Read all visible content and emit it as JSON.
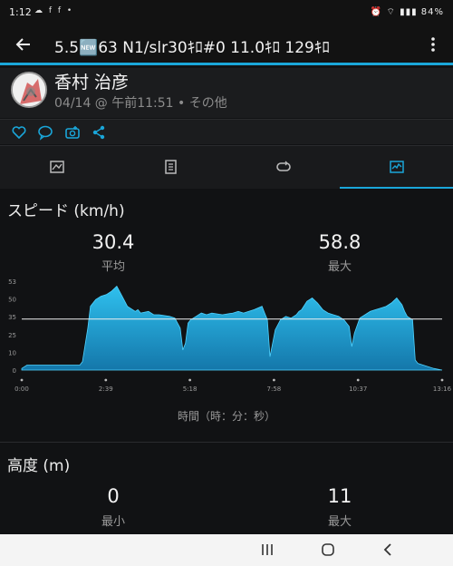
{
  "status_bar": {
    "time": "1:12",
    "left_icons": "☁ f f •",
    "right_icons": "⏰ ⌔ ▮▮▮ ",
    "battery": "84%"
  },
  "app_bar": {
    "title": "5.5🆕63 N1/slr30ｷﾛ#0 11.0ｷﾛ 129ｷﾛ"
  },
  "profile": {
    "name": "香村 治彦",
    "meta": "04/14 @ 午前11:51 • その他"
  },
  "speed": {
    "title": "スピード (km/h)",
    "avg_value": "30.4",
    "avg_label": "平均",
    "max_value": "58.8",
    "max_label": "最大",
    "x_axis_title": "時間（時：分：秒）"
  },
  "altitude": {
    "title": "高度 (m)",
    "min_value": "0",
    "min_label": "最小",
    "max_value": "11",
    "max_label": "最大"
  },
  "colors": {
    "accent": "#1aa6d9",
    "area_top": "#2fc0ee",
    "area_bottom": "#1477aa"
  },
  "chart_data": {
    "type": "area",
    "title": "スピード (km/h)",
    "xlabel": "時間（時：分：秒）",
    "ylabel": "",
    "x_tick_labels": [
      "0:00",
      "2:39",
      "5:18",
      "7:58",
      "10:37",
      "13:16"
    ],
    "y_tick_labels": [
      "0",
      "10",
      "25",
      "35",
      "50",
      "53"
    ],
    "ylim": [
      0,
      53
    ],
    "xlim": [
      0,
      796
    ],
    "avg_line": 30.4,
    "series": [
      {
        "values_x": [
          0,
          10,
          60,
          110,
          115,
          125,
          130,
          140,
          150,
          160,
          170,
          180,
          190,
          200,
          210,
          215,
          220,
          225,
          240,
          250,
          260,
          280,
          290,
          300,
          305,
          310,
          315,
          320,
          330,
          340,
          350,
          360,
          380,
          400,
          410,
          420,
          440,
          455,
          460,
          465,
          470,
          480,
          490,
          500,
          510,
          520,
          525,
          530,
          540,
          550,
          560,
          570,
          580,
          590,
          600,
          610,
          620,
          625,
          630,
          640,
          650,
          660,
          670,
          680,
          690,
          700,
          710,
          715,
          720,
          725,
          730,
          740,
          745,
          750,
          760,
          780,
          796
        ],
        "values_y": [
          1,
          3,
          3,
          3,
          5,
          25,
          38,
          42,
          44,
          45,
          47,
          50,
          44,
          38,
          36,
          35,
          36,
          34,
          35,
          33,
          33,
          32,
          31,
          25,
          12,
          16,
          28,
          30,
          32,
          34,
          33,
          34,
          33,
          34,
          35,
          34,
          36,
          38,
          34,
          30,
          8,
          24,
          30,
          32,
          31,
          33,
          35,
          36,
          41,
          43,
          40,
          36,
          34,
          33,
          32,
          30,
          26,
          14,
          22,
          31,
          33,
          35,
          36,
          37,
          38,
          40,
          43,
          41,
          39,
          35,
          32,
          30,
          6,
          4,
          3,
          1,
          0
        ]
      }
    ]
  }
}
